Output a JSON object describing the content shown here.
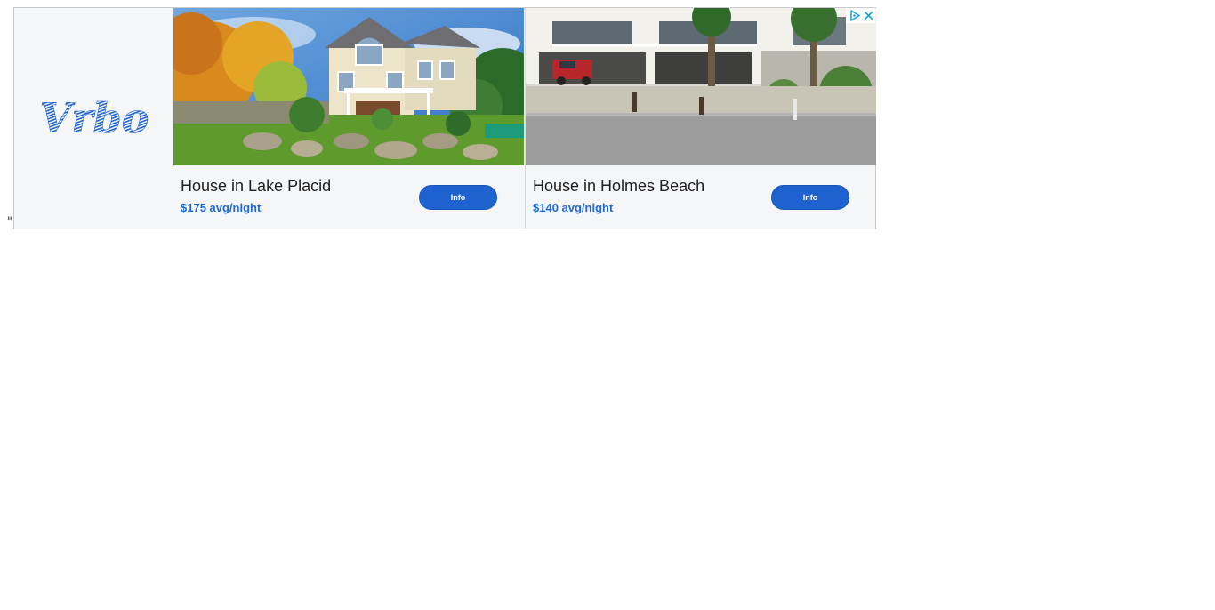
{
  "stray_text": "\"",
  "brand": {
    "name": "Vrbo",
    "logo_text": "Vrbo",
    "color": "#1e62d0"
  },
  "adchoices": {
    "icon": "adchoices-icon",
    "close_icon": "close-icon",
    "color": "#1aa3d8"
  },
  "listings": [
    {
      "title": "House in Lake Placid",
      "price": "$175 avg/night",
      "button_label": "Info",
      "photo": "two-story-cream-house-autumn-trees"
    },
    {
      "title": "House in Holmes Beach",
      "price": "$140 avg/night",
      "button_label": "Info",
      "photo": "white-beach-house-palm-trees-street"
    }
  ],
  "colors": {
    "price": "#1f6ad8",
    "button": "#1e62d0",
    "panel_bg": "#f5f6f8"
  }
}
